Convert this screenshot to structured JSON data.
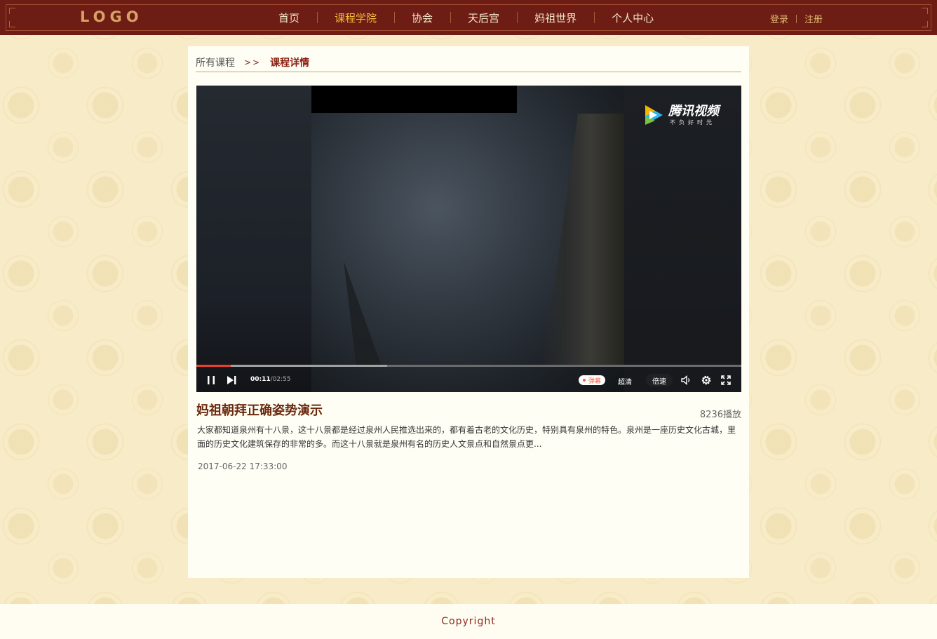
{
  "header": {
    "logo": "LOGO",
    "nav": [
      {
        "label": "首页",
        "active": false
      },
      {
        "label": "课程学院",
        "active": true
      },
      {
        "label": "协会",
        "active": false
      },
      {
        "label": "天后宫",
        "active": false
      },
      {
        "label": "妈祖世界",
        "active": false
      },
      {
        "label": "个人中心",
        "active": false
      }
    ],
    "login": "登录",
    "register": "注册"
  },
  "breadcrumb": {
    "parent": "所有课程",
    "separator": ">>",
    "current": "课程详情"
  },
  "player": {
    "brand": "腾讯视频",
    "brand_slogan": "不负好时光",
    "current_time": "00:11",
    "total_time": "/02:55",
    "progress": 0.063,
    "buffered": 0.35,
    "danmu_label": "弹幕",
    "quality_label": "超清",
    "speed_label": "倍速"
  },
  "video": {
    "title": "妈祖朝拜正确姿势演示",
    "plays": "8236播放",
    "description": "大家都知道泉州有十八景，这十八景都是经过泉州人民推选出来的，都有着古老的文化历史，特别具有泉州的特色。泉州是一座历史文化古城，里面的历史文化建筑保存的非常的多。而这十八景就是泉州有名的历史人文景点和自然景点更...",
    "date": "2017-06-22 17:33:00"
  },
  "footer": {
    "copyright": "Copyright"
  },
  "colors": {
    "header_bg": "#6e1d14",
    "nav_active": "#f5b93a",
    "accent": "#8a1f10",
    "progress": "#e8402e"
  }
}
